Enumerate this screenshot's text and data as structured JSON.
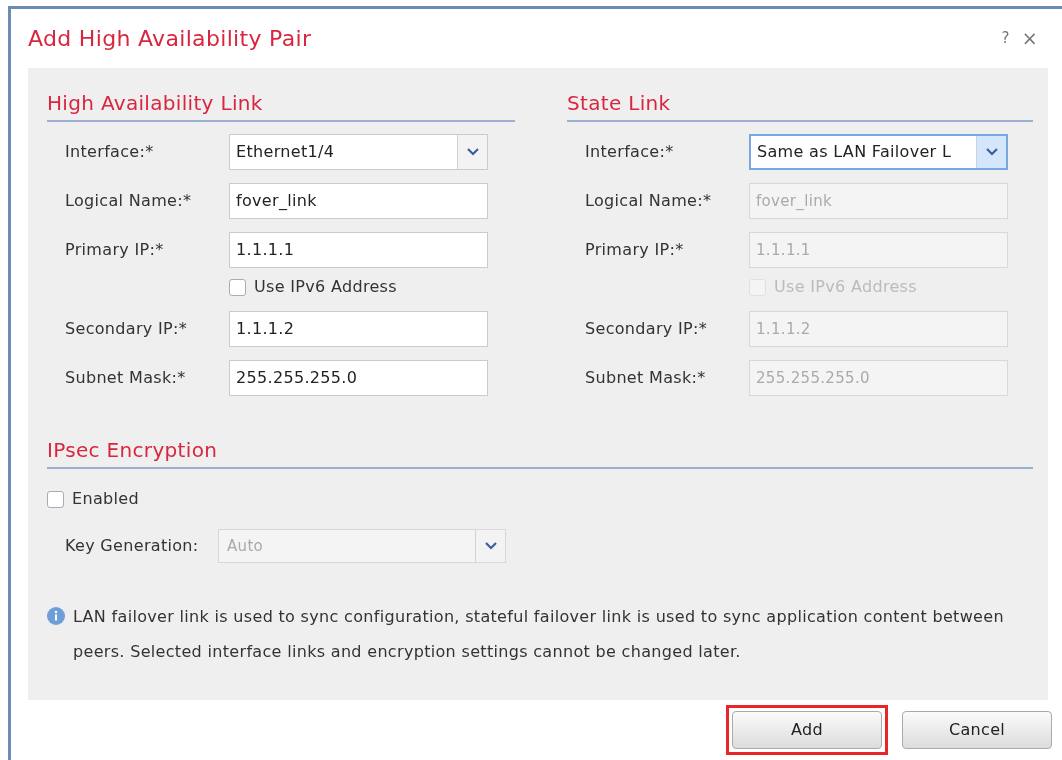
{
  "dialog": {
    "title": "Add High Availability Pair",
    "help": "?",
    "close": "×"
  },
  "sections": [
    {
      "title": "High Availability Link",
      "fields": [
        {
          "kind": "select",
          "label": "Interface:*",
          "value": "Ethernet1/4",
          "disabled": false,
          "focused": false
        },
        {
          "kind": "text",
          "label": "Logical Name:*",
          "value": "fover_link",
          "disabled": false
        },
        {
          "kind": "text",
          "label": "Primary IP:*",
          "value": "1.1.1.1",
          "disabled": false
        },
        {
          "kind": "checkbox",
          "label": "Use IPv6 Address",
          "checked": false,
          "disabled": false
        },
        {
          "kind": "text",
          "label": "Secondary IP:*",
          "value": "1.1.1.2",
          "disabled": false
        },
        {
          "kind": "text",
          "label": "Subnet Mask:*",
          "value": "255.255.255.0",
          "disabled": false
        }
      ]
    },
    {
      "title": "State Link",
      "fields": [
        {
          "kind": "select",
          "label": "Interface:*",
          "value": "Same as LAN Failover L",
          "disabled": false,
          "focused": true
        },
        {
          "kind": "text",
          "label": "Logical Name:*",
          "value": "fover_link",
          "disabled": true
        },
        {
          "kind": "text",
          "label": "Primary IP:*",
          "value": "1.1.1.1",
          "disabled": true
        },
        {
          "kind": "checkbox",
          "label": "Use IPv6 Address",
          "checked": false,
          "disabled": true
        },
        {
          "kind": "text",
          "label": "Secondary IP:*",
          "value": "1.1.1.2",
          "disabled": true
        },
        {
          "kind": "text",
          "label": "Subnet Mask:*",
          "value": "255.255.255.0",
          "disabled": true
        }
      ]
    }
  ],
  "ipsec": {
    "title": "IPsec Encryption",
    "enabled": {
      "label": "Enabled",
      "checked": false
    },
    "key_generation": {
      "label": "Key Generation:",
      "value": "Auto",
      "disabled": true
    }
  },
  "info": "LAN failover link is used to sync configuration, stateful failover link is used to sync application content between peers. Selected interface links and encryption settings cannot be changed later.",
  "buttons": [
    {
      "label": "Add",
      "highlighted": true
    },
    {
      "label": "Cancel",
      "highlighted": false
    }
  ]
}
